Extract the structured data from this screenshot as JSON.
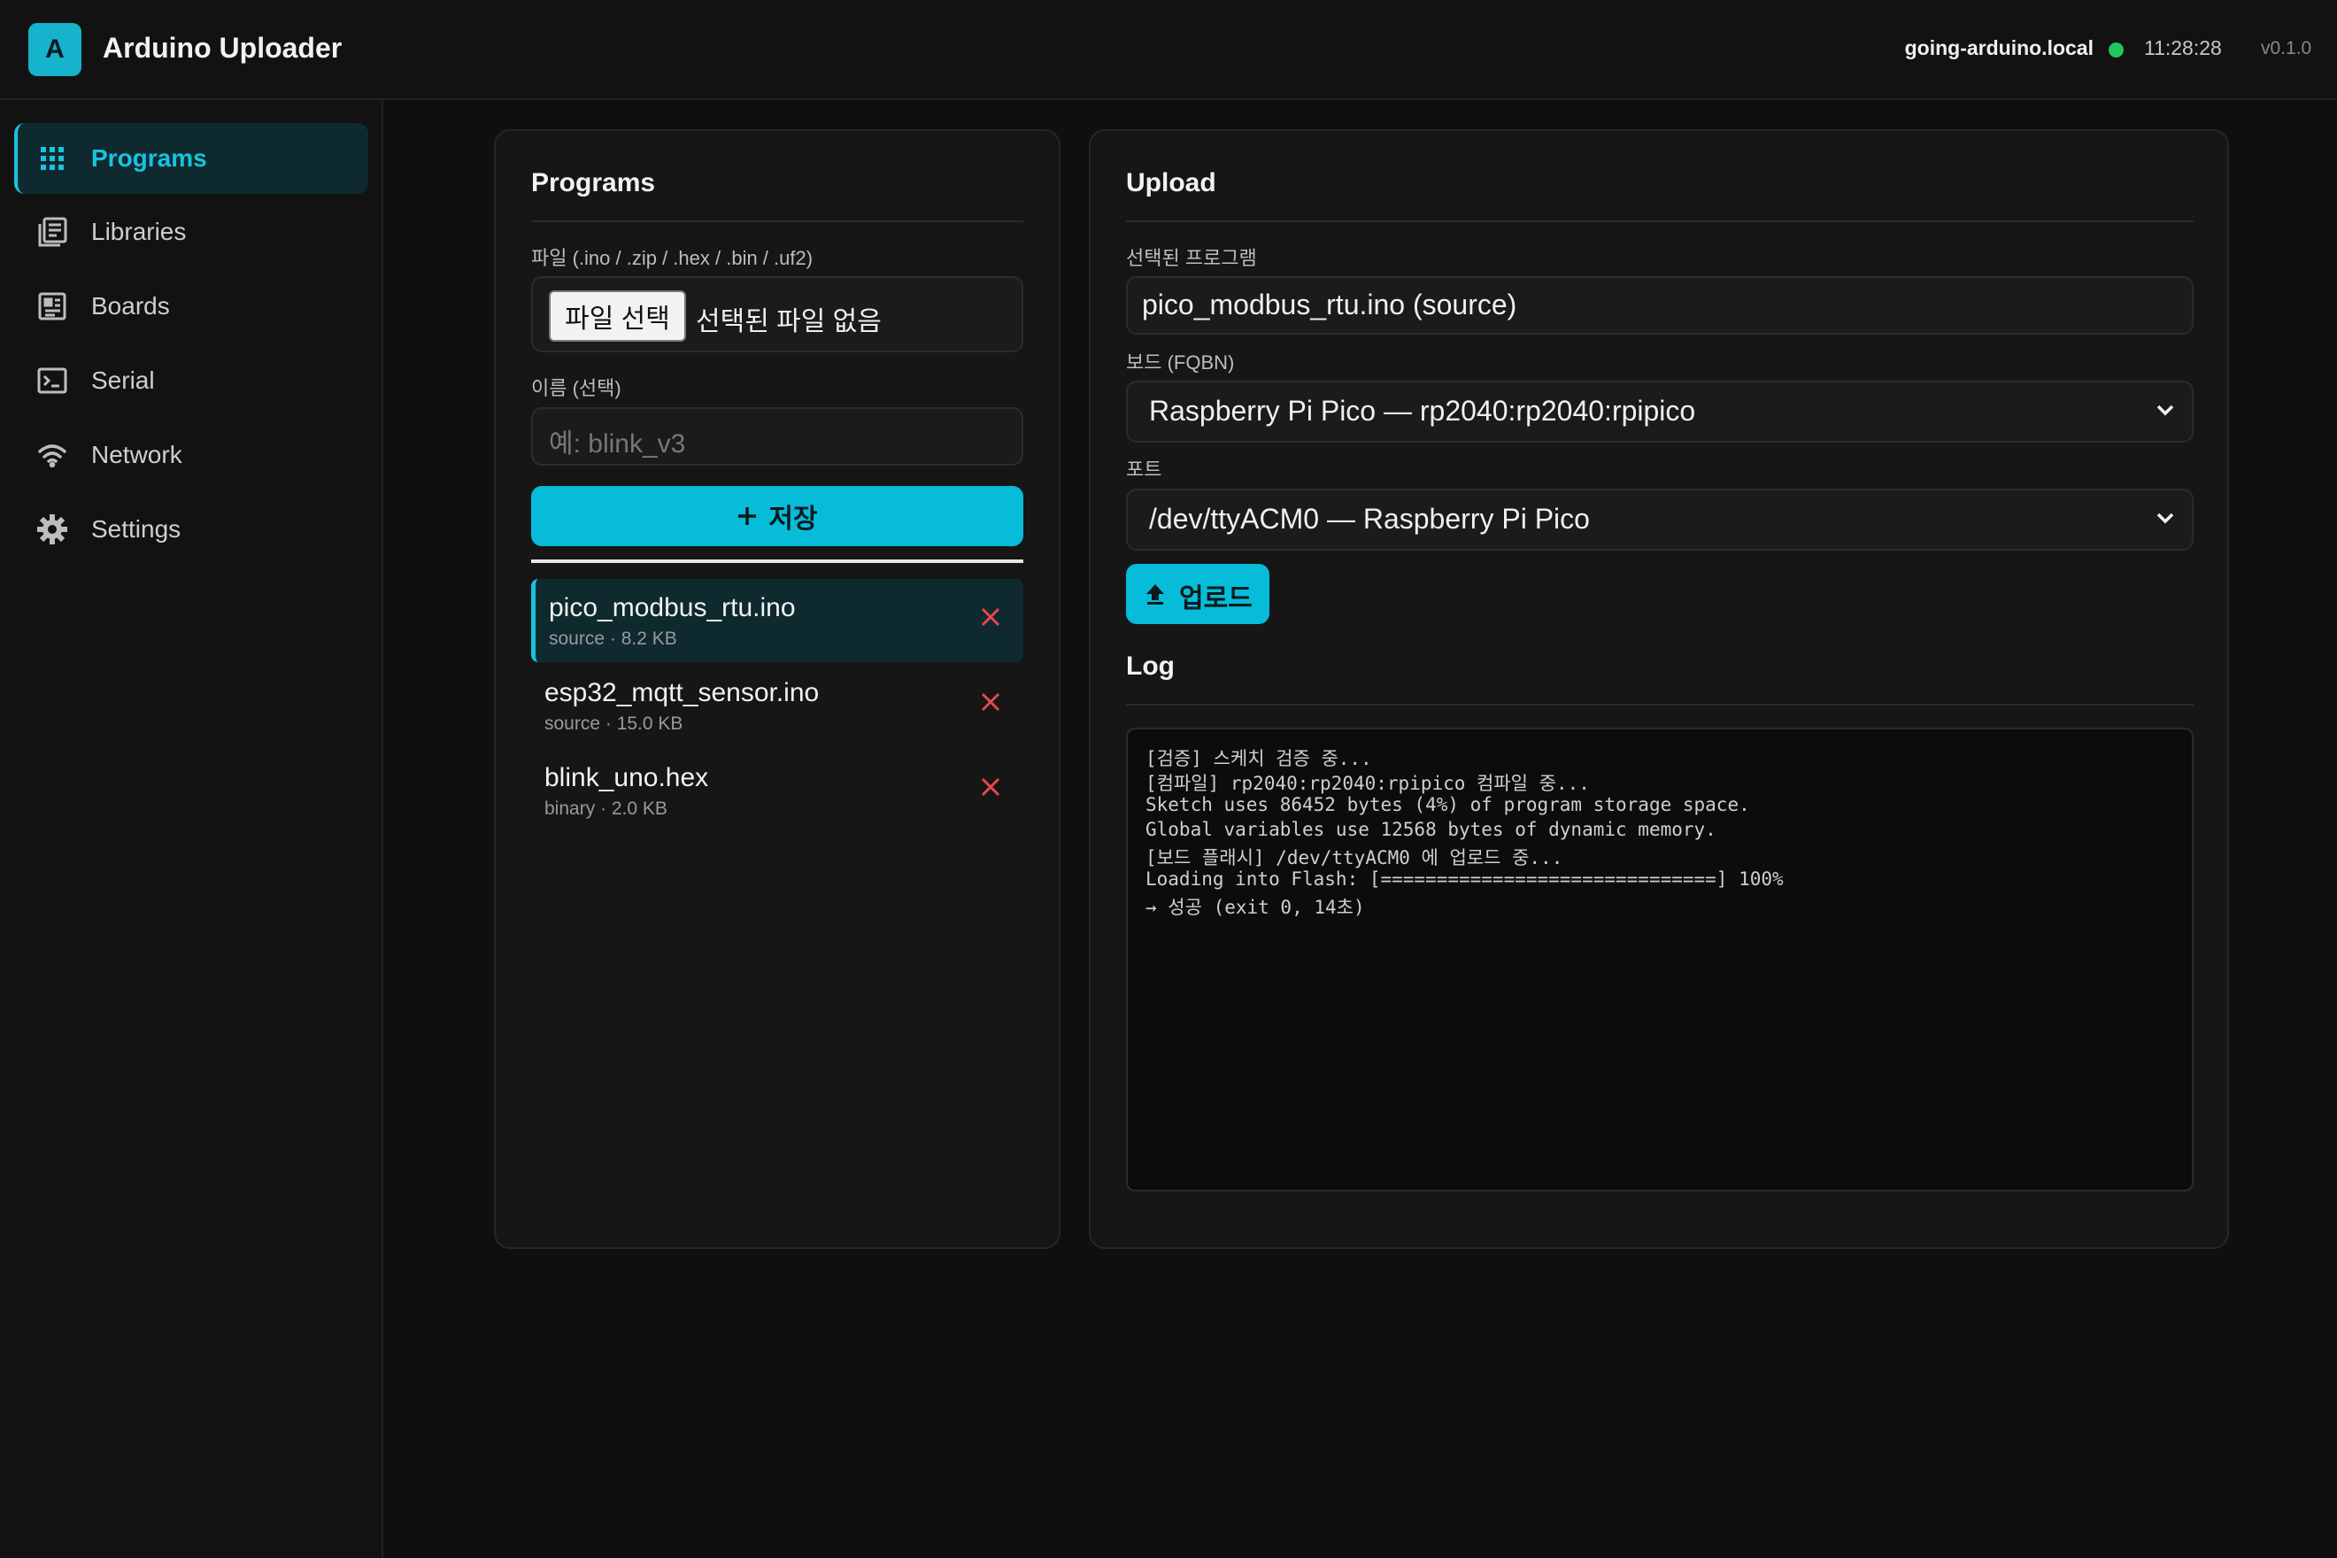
{
  "header": {
    "logo_letter": "A",
    "app_title": "Arduino Uploader",
    "host": "going-arduino.local",
    "status_color": "#22c55e",
    "time": "11:28:28",
    "version": "v0.1.0"
  },
  "sidebar": {
    "items": [
      {
        "label": "Programs",
        "icon": "grid-icon",
        "active": true
      },
      {
        "label": "Libraries",
        "icon": "library-icon",
        "active": false
      },
      {
        "label": "Boards",
        "icon": "board-icon",
        "active": false
      },
      {
        "label": "Serial",
        "icon": "terminal-icon",
        "active": false
      },
      {
        "label": "Network",
        "icon": "wifi-icon",
        "active": false
      },
      {
        "label": "Settings",
        "icon": "gear-icon",
        "active": false
      }
    ]
  },
  "programs": {
    "title": "Programs",
    "file_label": "파일 (.ino / .zip / .hex / .bin / .uf2)",
    "file_button": "파일 선택",
    "file_none": "선택된 파일 없음",
    "name_label": "이름 (선택)",
    "name_placeholder": "예: blink_v3",
    "save_button": "저장",
    "save_icon": "plus-icon",
    "list": [
      {
        "name": "pico_modbus_rtu.ino",
        "meta": "source · 8.2 KB",
        "selected": true
      },
      {
        "name": "esp32_mqtt_sensor.ino",
        "meta": "source · 15.0 KB",
        "selected": false
      },
      {
        "name": "blink_uno.hex",
        "meta": "binary · 2.0 KB",
        "selected": false
      }
    ]
  },
  "upload": {
    "title": "Upload",
    "selected_label": "선택된 프로그램",
    "selected_value": "pico_modbus_rtu.ino (source)",
    "board_label": "보드 (FQBN)",
    "board_value": "Raspberry Pi Pico — rp2040:rp2040:rpipico",
    "port_label": "포트",
    "port_value": "/dev/ttyACM0 — Raspberry Pi Pico",
    "upload_button": "업로드",
    "upload_icon": "upload-arrow-icon",
    "log_title": "Log",
    "log_lines": [
      "[검증] 스케치 검증 중...",
      "[컴파일] rp2040:rp2040:rpipico 컴파일 중...",
      "Sketch uses 86452 bytes (4%) of program storage space.",
      "Global variables use 12568 bytes of dynamic memory.",
      "[보드 플래시] /dev/ttyACM0 에 업로드 중...",
      "Loading into Flash: [==============================] 100%",
      "→ 성공 (exit 0, 14초)"
    ]
  },
  "colors": {
    "accent": "#06bcd8",
    "delete": "#e5484d",
    "background": "#0f0f0f"
  }
}
